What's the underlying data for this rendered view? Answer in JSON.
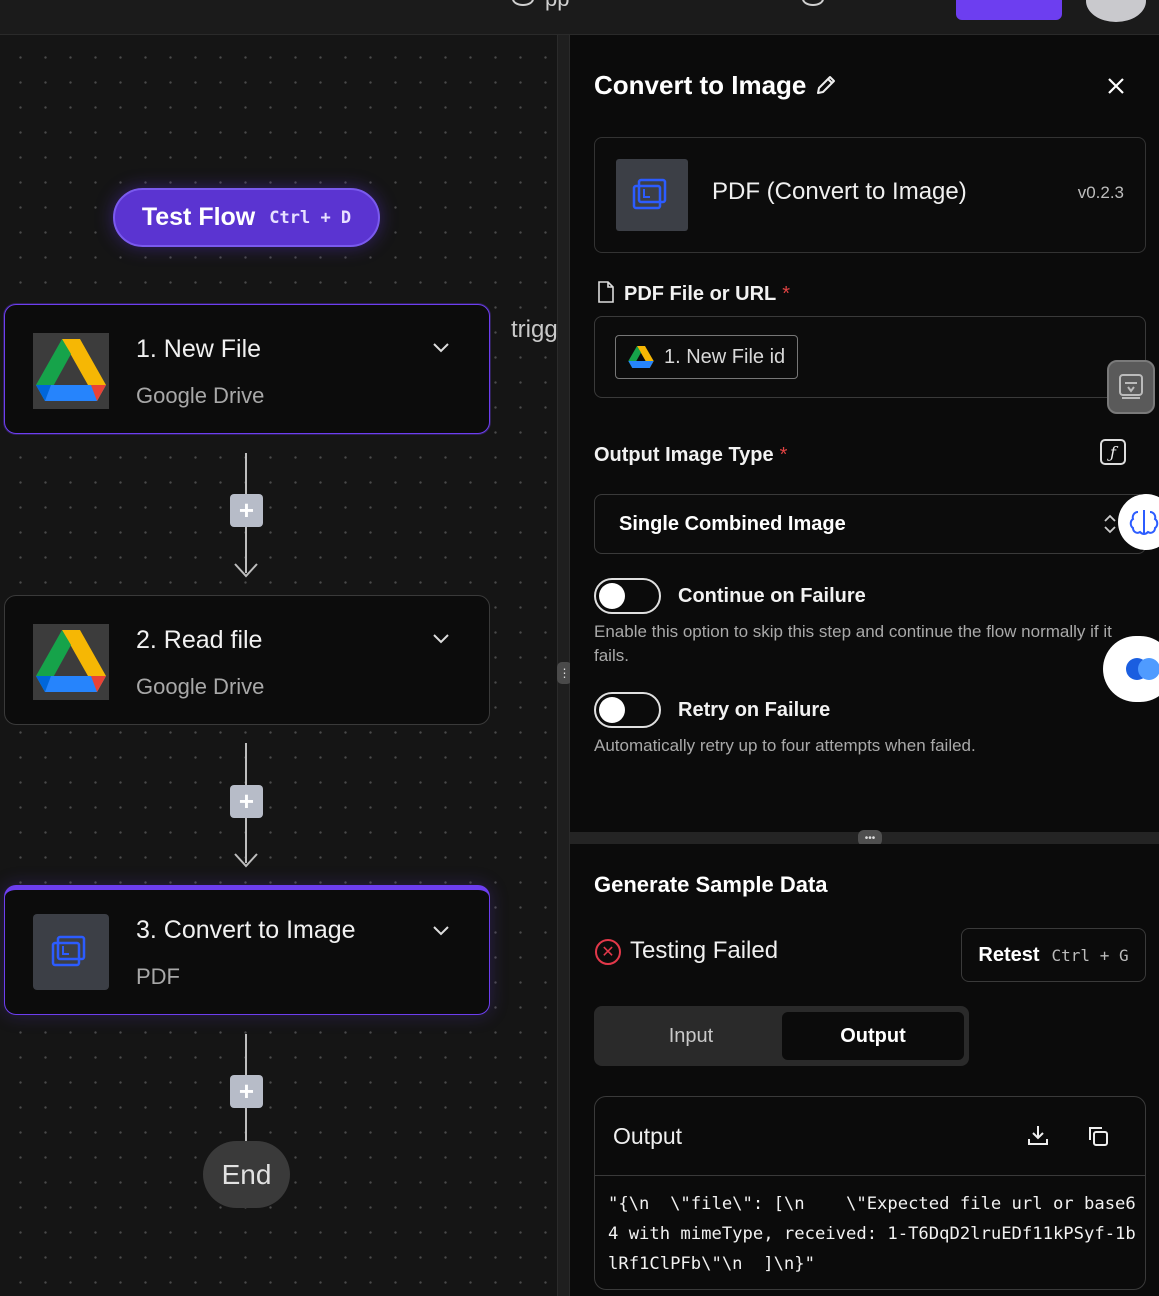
{
  "canvas": {
    "test_flow": {
      "label": "Test Flow",
      "shortcut": "Ctrl + D"
    },
    "steps": [
      {
        "title": "1. New File",
        "subtitle": "Google Drive",
        "icon": "google-drive-icon"
      },
      {
        "title": "2. Read file",
        "subtitle": "Google Drive",
        "icon": "google-drive-icon"
      },
      {
        "title": "3. Convert to Image",
        "subtitle": "PDF",
        "icon": "pdf-convert-icon"
      }
    ],
    "end_label": "End",
    "partial_text": "trigg"
  },
  "panel": {
    "title": "Convert to Image",
    "piece": {
      "name": "PDF (Convert to Image)",
      "version": "v0.2.3"
    },
    "pdf_field": {
      "label": "PDF File or URL",
      "required": "*",
      "chip_label": "1. New File id"
    },
    "output_type": {
      "label": "Output Image Type",
      "required": "*",
      "value": "Single Combined Image"
    },
    "continue_on_failure": {
      "label": "Continue on Failure",
      "description": "Enable this option to skip this step and continue the flow normally if it fails."
    },
    "retry_on_failure": {
      "label": "Retry on Failure",
      "description": "Automatically retry up to four attempts when failed."
    }
  },
  "sample": {
    "title": "Generate Sample Data",
    "status": "Testing Failed",
    "retest": {
      "label": "Retest",
      "shortcut": "Ctrl + G"
    },
    "tabs": {
      "input": "Input",
      "output": "Output"
    },
    "output_title": "Output",
    "output_text": "\"{\\n  \\\"file\\\": [\\n    \\\"Expected file url or base64 with mimeType, received: 1-T6DqD2lruEDf11kPSyf-1blRf1ClPFb\\\"\\n  ]\\n}\""
  },
  "colors": {
    "accent": "#6d3ef0",
    "error": "#e2384a"
  }
}
